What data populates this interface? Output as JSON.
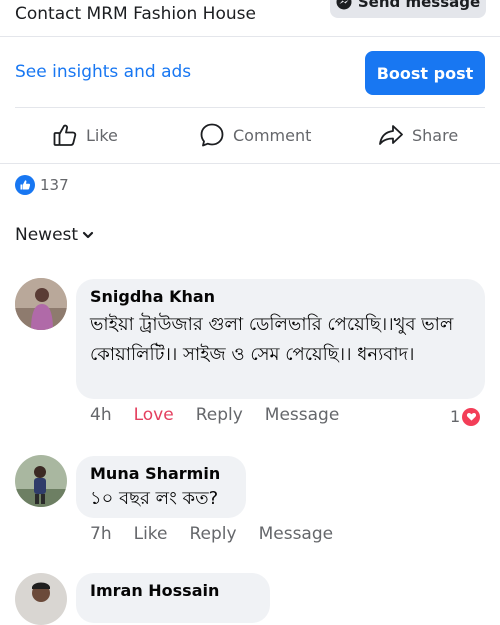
{
  "header": {
    "contact_title": "Contact MRM Fashion House",
    "send_message_label": "Send message"
  },
  "promo": {
    "insights_link": "See insights and ads",
    "boost_label": "Boost post"
  },
  "actions": {
    "like": "Like",
    "comment": "Comment",
    "share": "Share"
  },
  "reactions": {
    "count": "137",
    "icon": "thumbs-up-icon"
  },
  "sort": {
    "label": "Newest"
  },
  "comments": [
    {
      "name": "Snigdha Khan",
      "text": "ভাইয়া ট্রাউজার গুলা ডেলিভারি পেয়েছি।।খুব ভাল কোয়ালিটি।। সাইজ ও সেম পেয়েছি।। ধন্যবাদ।",
      "time": "4h",
      "reaction_action": "Love",
      "reply": "Reply",
      "message": "Message",
      "reaction_count": "1"
    },
    {
      "name": "Muna Sharmin",
      "text": "১০ বছর লং কত?",
      "time": "7h",
      "reaction_action": "Like",
      "reply": "Reply",
      "message": "Message"
    },
    {
      "name": "Imran Hossain"
    }
  ],
  "colors": {
    "accent": "#1877f2",
    "love": "#e4405f",
    "bubble": "#f0f2f5",
    "muted": "#65676b"
  }
}
